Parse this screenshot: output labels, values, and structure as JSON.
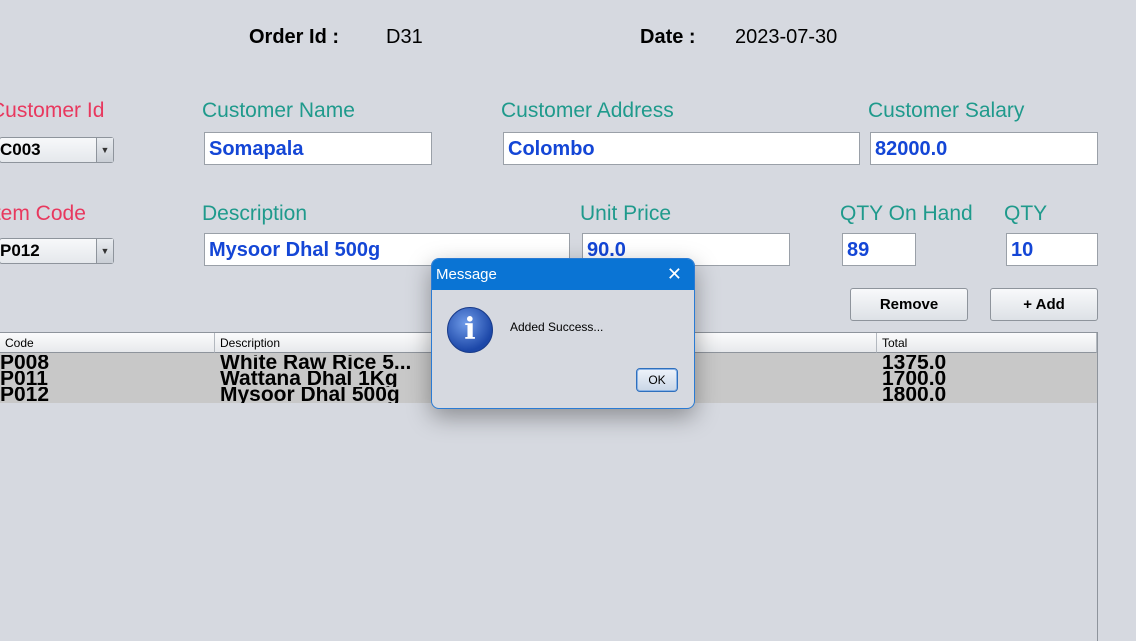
{
  "header": {
    "order_id_label": "Order Id :",
    "order_id_value": "D31",
    "date_label": "Date :",
    "date_value": "2023-07-30"
  },
  "customer": {
    "id_label": "Customer Id",
    "id_value": "C003",
    "name_label": "Customer Name",
    "name_value": "Somapala",
    "address_label": "Customer Address",
    "address_value": "Colombo",
    "salary_label": "Customer Salary",
    "salary_value": "82000.0"
  },
  "item": {
    "code_label": "Item Code",
    "code_value": "P012",
    "description_label": "Description",
    "description_value": "Mysoor Dhal 500g",
    "unit_price_label": "Unit Price",
    "unit_price_value": "90.0",
    "qty_on_hand_label": "QTY On Hand",
    "qty_on_hand_value": "89",
    "qty_label": "QTY",
    "qty_value": "10"
  },
  "buttons": {
    "remove": "Remove",
    "add": "+ Add"
  },
  "table": {
    "columns": [
      "Code",
      "Description",
      "Total"
    ],
    "rows": [
      {
        "code": "P008",
        "description": "White Raw Rice 5...",
        "total": "1375.0"
      },
      {
        "code": "P011",
        "description": "Wattana Dhal 1Kg",
        "total": "1700.0"
      },
      {
        "code": "P012",
        "description": "Mysoor Dhal 500g",
        "total": "1800.0"
      }
    ]
  },
  "dialog": {
    "title": "Message",
    "close": "✕",
    "icon": "info-icon",
    "icon_glyph": "i",
    "message": "Added Success...",
    "ok": "OK"
  },
  "colors": {
    "background": "#d6d9e0",
    "label_teal": "#1f9a8c",
    "label_red": "#e8385e",
    "field_text": "#1446d6",
    "dialog_title_bar": "#0a74d4"
  }
}
